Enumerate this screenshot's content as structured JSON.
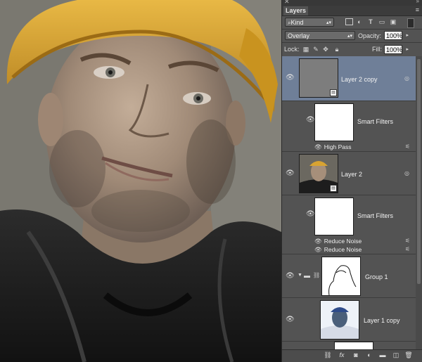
{
  "panel": {
    "tab_label": "Layers",
    "filter": {
      "value": "Kind"
    },
    "blend": {
      "mode": "Overlay",
      "opacity_label": "Opacity:",
      "opacity_value": "100%"
    },
    "lock": {
      "lock_label": "Lock:",
      "fill_label": "Fill:",
      "fill_value": "100%"
    },
    "layers": [
      {
        "name": "Layer 2 copy",
        "selected": true
      },
      {
        "name": "Smart Filters",
        "filters": [
          "High Pass"
        ]
      },
      {
        "name": "Layer 2"
      },
      {
        "name": "Smart Filters",
        "filters": [
          "Reduce Noise",
          "Reduce Noise"
        ]
      },
      {
        "name": "Group 1"
      },
      {
        "name": "Layer 1 copy"
      }
    ]
  },
  "icons": {
    "close": "close-icon",
    "collapse": "double-arrow-icon",
    "panel_menu": "panel-menu-icon",
    "visibility": "eye-icon",
    "smart_object": "smart-object-icon",
    "folder": "folder-icon",
    "link": "link-icon",
    "filter_options": "filter-options-icon",
    "bottom": [
      "link-layers-icon",
      "fx-icon",
      "mask-icon",
      "adjustment-icon",
      "new-group-icon",
      "new-layer-icon",
      "trash-icon"
    ]
  },
  "colors": {
    "panel_bg": "#535353",
    "selected_row": "#6f7f98",
    "helmet": "#d8a332"
  }
}
